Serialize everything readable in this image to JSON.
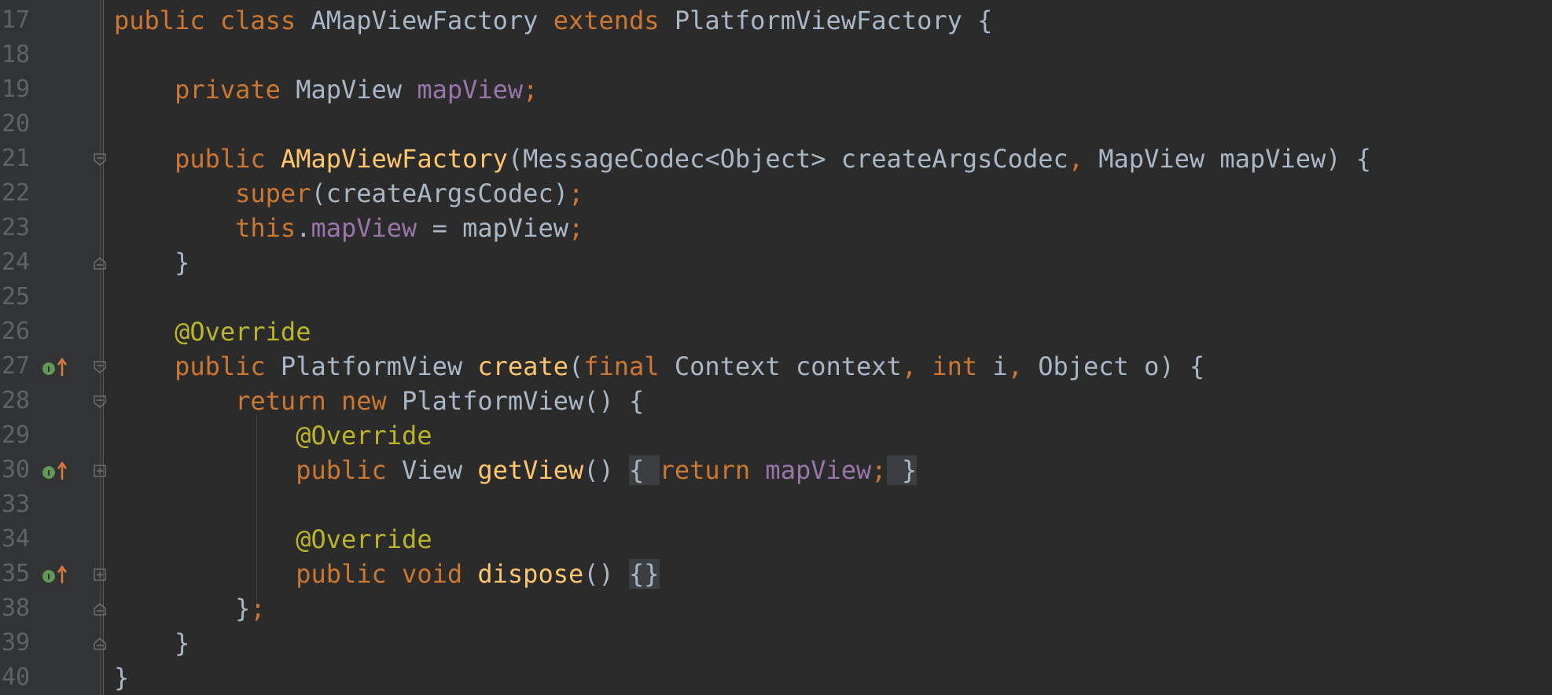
{
  "editor": {
    "lines": [
      {
        "n": "17",
        "t": [
          "public ",
          "class ",
          "AMapViewFactory ",
          "extends ",
          "PlatformViewFactory {"
        ]
      },
      {
        "n": "18"
      },
      {
        "n": "19",
        "t": [
          "    ",
          "private ",
          "MapView ",
          "mapView",
          ";"
        ]
      },
      {
        "n": "20"
      },
      {
        "n": "21",
        "t": [
          "    ",
          "public ",
          "AMapViewFactory",
          "(MessageCodec<Object> createArgsCodec",
          ", ",
          "MapView mapView) {"
        ]
      },
      {
        "n": "22",
        "t": [
          "        ",
          "super",
          "(createArgsCodec)",
          ";"
        ]
      },
      {
        "n": "23",
        "t": [
          "        ",
          "this",
          ".",
          "mapView",
          " = mapView",
          ";"
        ]
      },
      {
        "n": "24",
        "t": [
          "    }"
        ]
      },
      {
        "n": "25"
      },
      {
        "n": "26",
        "t": [
          "    ",
          "@Override"
        ]
      },
      {
        "n": "27",
        "t": [
          "    ",
          "public ",
          "PlatformView ",
          "create",
          "(",
          "final ",
          "Context context",
          ", ",
          "int ",
          "i",
          ", ",
          "Object o) {"
        ]
      },
      {
        "n": "28",
        "t": [
          "        ",
          "return ",
          "new ",
          "PlatformView() {"
        ]
      },
      {
        "n": "29",
        "t": [
          "            ",
          "@Override"
        ]
      },
      {
        "n": "30",
        "t": [
          "            ",
          "public ",
          "View ",
          "getView",
          "() ",
          "{ ",
          "return ",
          "mapView",
          ";",
          " }"
        ]
      },
      {
        "n": "33"
      },
      {
        "n": "34",
        "t": [
          "            ",
          "@Override"
        ]
      },
      {
        "n": "35",
        "t": [
          "            ",
          "public ",
          "void ",
          "dispose",
          "() ",
          "{}"
        ]
      },
      {
        "n": "38",
        "t": [
          "        }",
          ";"
        ]
      },
      {
        "n": "39",
        "t": [
          "    }"
        ]
      },
      {
        "n": "40",
        "t": [
          "}"
        ]
      }
    ],
    "markers": {
      "implements_icon": "implements-method-icon",
      "fold_icon": "fold-icon",
      "collapsed_icon": "collapsed-fold-icon"
    },
    "colors": {
      "background": "#2b2b2b",
      "gutter": "#313335",
      "keyword": "#cc7832",
      "function": "#ffc66d",
      "field": "#9876aa",
      "annotation": "#bbb529",
      "text": "#a9b7c6",
      "line_number": "#606366"
    }
  }
}
